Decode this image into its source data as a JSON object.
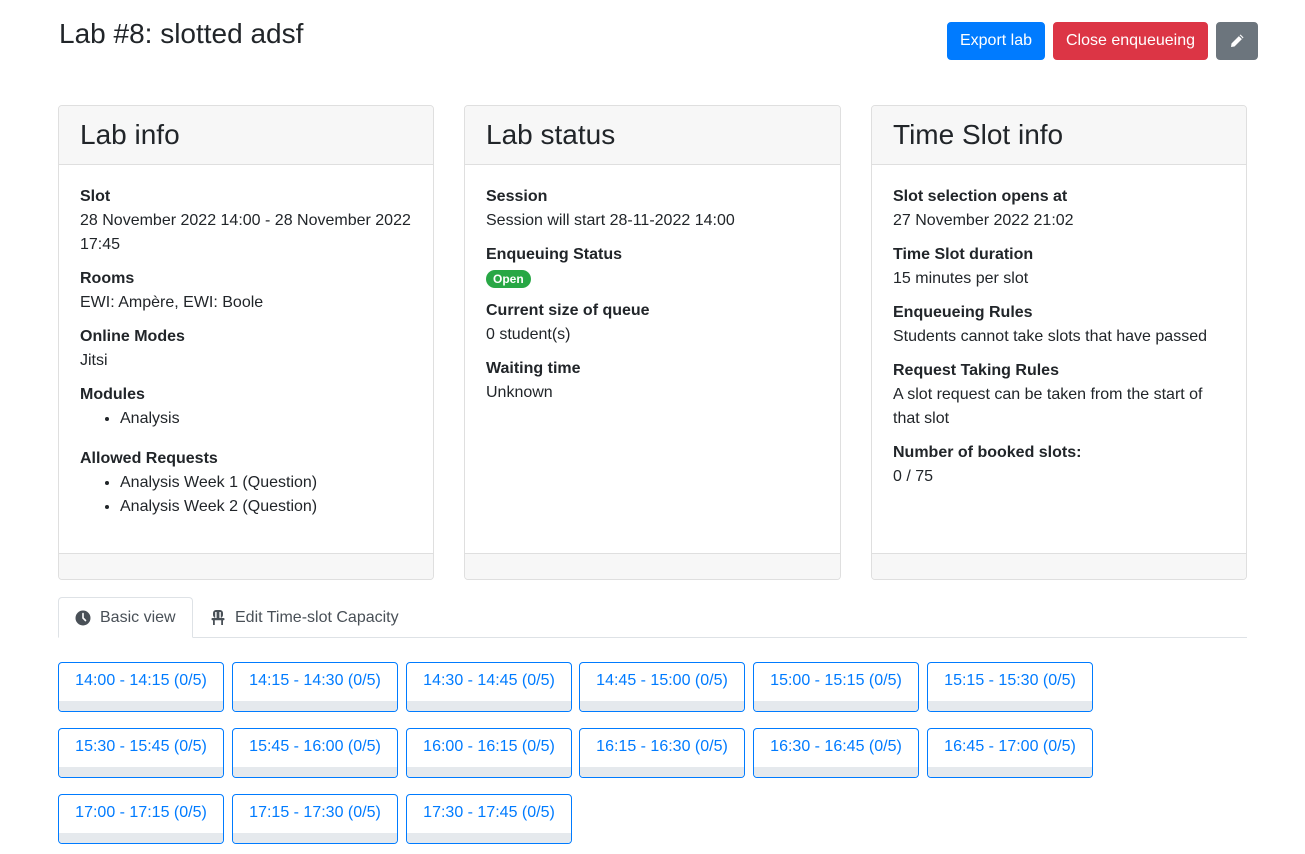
{
  "page": {
    "title": "Lab #8: slotted adsf"
  },
  "actions": {
    "export_label": "Export lab",
    "close_label": "Close enqueueing",
    "edit_icon": "pencil-icon"
  },
  "lab_info": {
    "title": "Lab info",
    "slot_label": "Slot",
    "slot_value": "28 November 2022 14:00 - 28 November 2022 17:45",
    "rooms_label": "Rooms",
    "rooms_value": "EWI: Ampère, EWI: Boole",
    "online_label": "Online Modes",
    "online_value": "Jitsi",
    "modules_label": "Modules",
    "modules": [
      "Analysis"
    ],
    "requests_label": "Allowed Requests",
    "requests": [
      "Analysis Week 1 (Question)",
      "Analysis Week 2 (Question)"
    ]
  },
  "lab_status": {
    "title": "Lab status",
    "session_label": "Session",
    "session_value": "Session will start 28-11-2022 14:00",
    "enqueue_label": "Enqueuing Status",
    "enqueue_badge": "Open",
    "queue_label": "Current size of queue",
    "queue_value": "0 student(s)",
    "waiting_label": "Waiting time",
    "waiting_value": "Unknown"
  },
  "timeslot_info": {
    "title": "Time Slot info",
    "opens_label": "Slot selection opens at",
    "opens_value": "27 November 2022 21:02",
    "duration_label": "Time Slot duration",
    "duration_value": "15 minutes per slot",
    "enqueue_rules_label": "Enqueueing Rules",
    "enqueue_rules_value": "Students cannot take slots that have passed",
    "taking_rules_label": "Request Taking Rules",
    "taking_rules_value": "A slot request can be taken from the start of that slot",
    "booked_label": "Number of booked slots:",
    "booked_value": "0 / 75"
  },
  "tabs": [
    {
      "label": "Basic view",
      "icon": "clock-icon",
      "active": true
    },
    {
      "label": "Edit Time-slot Capacity",
      "icon": "chair-icon",
      "active": false
    }
  ],
  "slots": [
    "14:00 - 14:15 (0/5)",
    "14:15 - 14:30 (0/5)",
    "14:30 - 14:45 (0/5)",
    "14:45 - 15:00 (0/5)",
    "15:00 - 15:15 (0/5)",
    "15:15 - 15:30 (0/5)",
    "15:30 - 15:45 (0/5)",
    "15:45 - 16:00 (0/5)",
    "16:00 - 16:15 (0/5)",
    "16:15 - 16:30 (0/5)",
    "16:30 - 16:45 (0/5)",
    "16:45 - 17:00 (0/5)",
    "17:00 - 17:15 (0/5)",
    "17:15 - 17:30 (0/5)",
    "17:30 - 17:45 (0/5)"
  ],
  "colors": {
    "primary": "#007bff",
    "danger": "#dc3545",
    "secondary": "#6c757d",
    "success": "#28a745"
  }
}
